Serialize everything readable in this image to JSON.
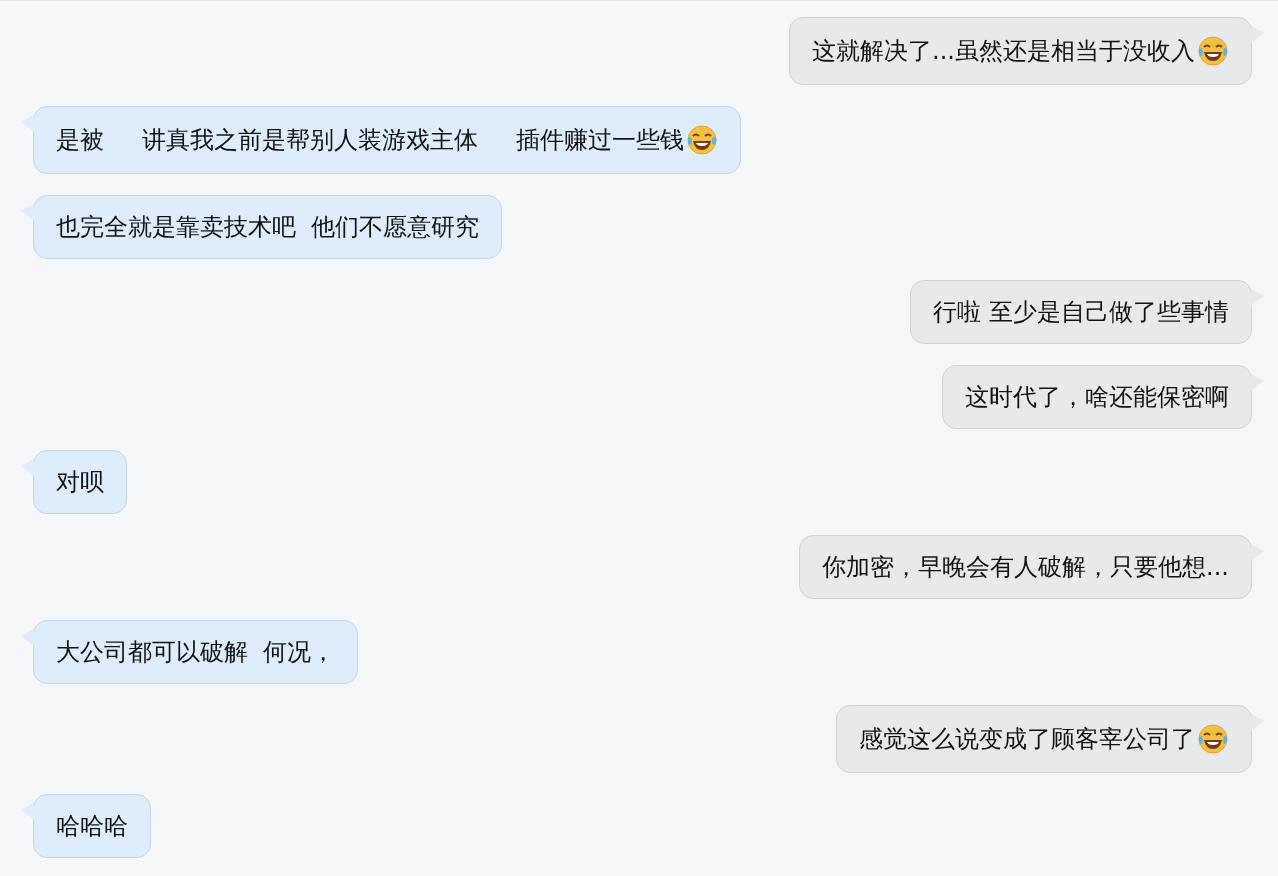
{
  "messages": [
    {
      "kind": "outgoing",
      "text": "这就解决了...虽然还是相当于没收入",
      "trailing_emoji": true
    },
    {
      "kind": "incoming",
      "text": "是被     讲真我之前是帮别人装游戏主体     插件赚过一些钱",
      "trailing_emoji": true
    },
    {
      "kind": "incoming",
      "text": "也完全就是靠卖技术吧  他们不愿意研究",
      "trailing_emoji": false
    },
    {
      "kind": "outgoing",
      "text": "行啦 至少是自己做了些事情",
      "trailing_emoji": false
    },
    {
      "kind": "outgoing",
      "text": "这时代了，啥还能保密啊",
      "trailing_emoji": false
    },
    {
      "kind": "incoming",
      "text": "对呗",
      "trailing_emoji": false
    },
    {
      "kind": "outgoing",
      "text": "你加密，早晚会有人破解，只要他想...",
      "trailing_emoji": false
    },
    {
      "kind": "incoming",
      "text": "大公司都可以破解  何况，",
      "trailing_emoji": false
    },
    {
      "kind": "outgoing",
      "text": "感觉这么说变成了顾客宰公司了",
      "trailing_emoji": true
    },
    {
      "kind": "incoming",
      "text": "哈哈哈",
      "trailing_emoji": false
    }
  ]
}
